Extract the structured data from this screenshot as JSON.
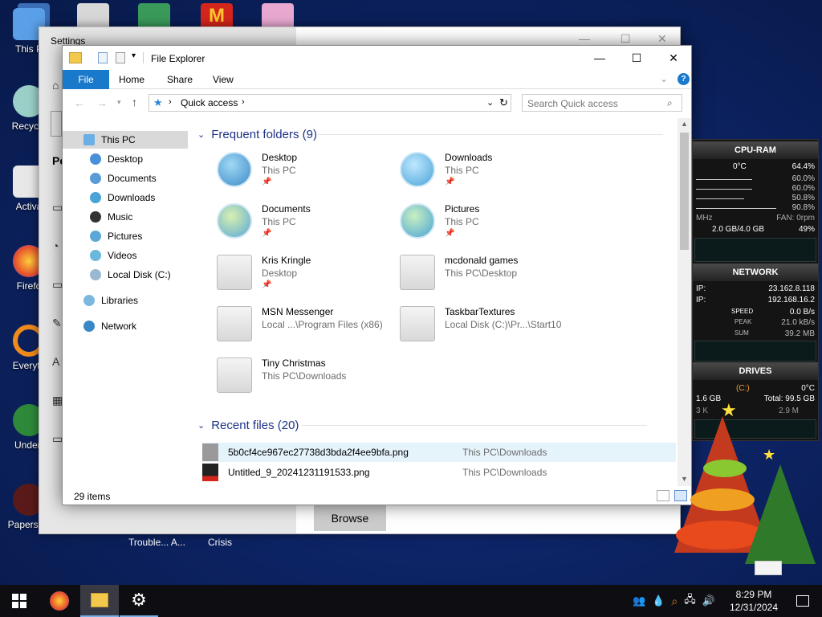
{
  "desktop": {
    "icons": [
      {
        "label": "This P"
      },
      {
        "label": "Recycle"
      },
      {
        "label": "Activa"
      },
      {
        "label": "Firefo"
      },
      {
        "label": "Everyth"
      },
      {
        "label": "Undert"
      },
      {
        "label": "Papers, P"
      }
    ],
    "below_window_labels": [
      "Trouble... A...",
      "Crisis"
    ]
  },
  "settings": {
    "title": "Settings",
    "partial_text": "Pe",
    "browse_label": "Browse"
  },
  "explorer": {
    "title": "File Explorer",
    "tabs": [
      "File",
      "Home",
      "Share",
      "View"
    ],
    "address": "Quick access",
    "search_placeholder": "Search Quick access",
    "nav": {
      "items": [
        {
          "label": "This PC",
          "selected": true
        },
        {
          "label": "Desktop"
        },
        {
          "label": "Documents"
        },
        {
          "label": "Downloads"
        },
        {
          "label": "Music"
        },
        {
          "label": "Pictures"
        },
        {
          "label": "Videos"
        },
        {
          "label": "Local Disk (C:)"
        },
        {
          "label": "Libraries"
        },
        {
          "label": "Network"
        }
      ]
    },
    "frequent": {
      "heading": "Frequent folders (9)",
      "folders": [
        {
          "name": "Desktop",
          "sub": "This PC"
        },
        {
          "name": "Downloads",
          "sub": "This PC"
        },
        {
          "name": "Documents",
          "sub": "This PC"
        },
        {
          "name": "Pictures",
          "sub": "This PC"
        },
        {
          "name": "Kris Kringle",
          "sub": "Desktop"
        },
        {
          "name": "mcdonald games",
          "sub": "This PC\\Desktop"
        },
        {
          "name": "MSN Messenger",
          "sub": "Local ...\\Program Files (x86)"
        },
        {
          "name": "TaskbarTextures",
          "sub": "Local Disk (C:)\\Pr...\\Start10"
        },
        {
          "name": "Tiny Christmas",
          "sub": "This PC\\Downloads"
        }
      ]
    },
    "recent": {
      "heading": "Recent files (20)",
      "files": [
        {
          "name": "5b0cf4ce967ec27738d3bda2f4ee9bfa.png",
          "location": "This PC\\Downloads"
        },
        {
          "name": "Untitled_9_20241231191533.png",
          "location": "This PC\\Downloads"
        }
      ]
    },
    "status": "29 items"
  },
  "gadget": {
    "cpu_header": "CPU-RAM",
    "cpu_temp": "0°C",
    "cpu_total": "64.4%",
    "cores": [
      "60.0%",
      "60.0%",
      "50.8%",
      "90.8%"
    ],
    "mhz_label": "MHz",
    "fan_label": "FAN: 0rpm",
    "ram": "2.0 GB/4.0 GB",
    "ram_pct": "49%",
    "network_header": "NETWORK",
    "ext_ip_label": "IP:",
    "ext_ip": "23.162.8.118",
    "int_ip_label": "IP:",
    "int_ip": "192.168.16.2",
    "speed_label": "SPEED",
    "speed": "0.0 B/s",
    "peak_label": "PEAK",
    "peak": "21.0 kB/s",
    "sum_label": "SUM",
    "sum": "39.2 MB",
    "drives_header": "DRIVES",
    "drive_name": "(C:)",
    "drive_temp": "0°C",
    "drive_used": "1.6 GB",
    "drive_total": "Total: 99.5 GB",
    "drive_left": "3 K",
    "drive_mid": "2.9 M"
  },
  "taskbar": {
    "time": "8:29 PM",
    "date": "12/31/2024"
  }
}
